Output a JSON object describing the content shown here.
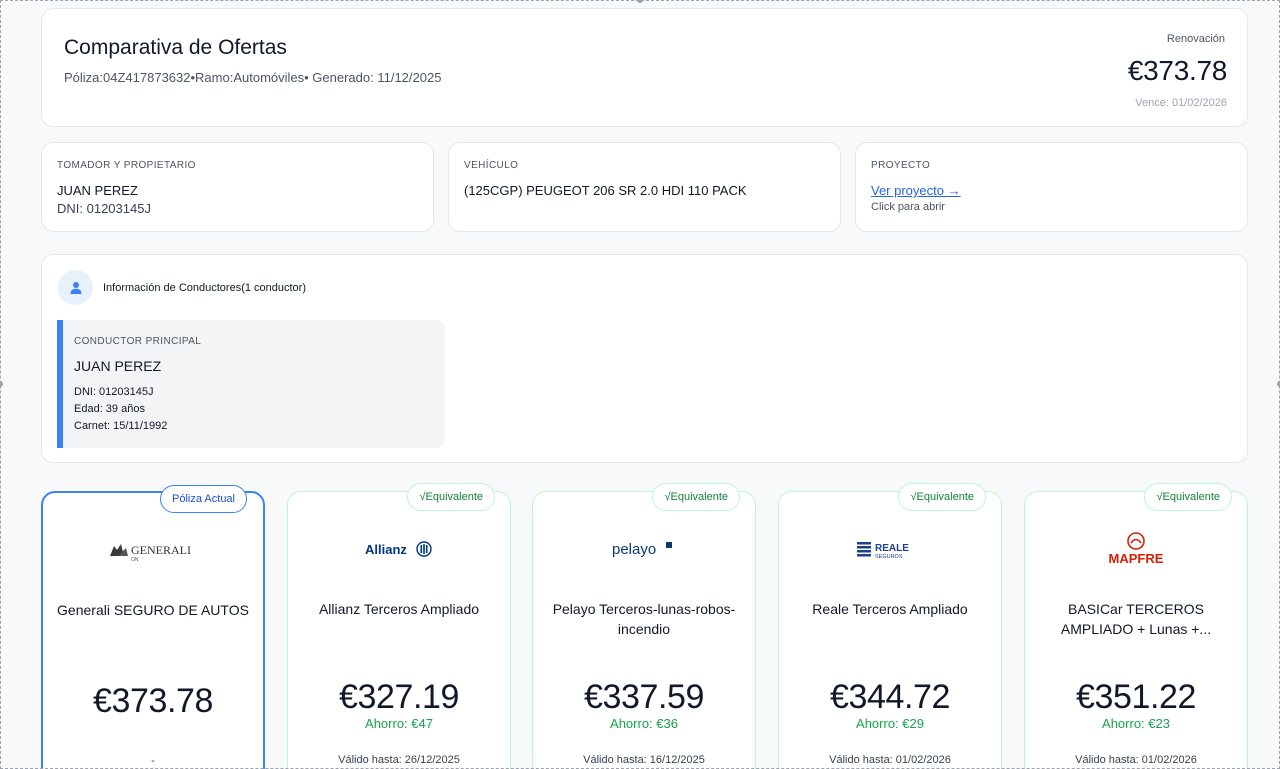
{
  "header": {
    "title": "Comparativa de Ofertas",
    "meta": "Póliza:04Z417873632•Ramo:Automóviles• Generado: 11/12/2025",
    "renewal_label": "Renovación",
    "renewal_price": "€373.78",
    "renewal_due": "Vence: 01/02/2026"
  },
  "info": {
    "holder": {
      "label": "TOMADOR Y PROPIETARIO",
      "name": "JUAN PEREZ",
      "dni": "DNI: 01203145J"
    },
    "vehicle": {
      "label": "VEHÍCULO",
      "value": "(125CGP) PEUGEOT 206 SR 2.0 HDI 110 PACK"
    },
    "project": {
      "label": "PROYECTO",
      "link": "Ver proyecto →",
      "hint": "Click para abrir"
    }
  },
  "drivers": {
    "title": "Información de Conductores(1 conductor)",
    "main": {
      "label": "CONDUCTOR PRINCIPAL",
      "name": "JUAN PEREZ",
      "dni": "DNI: 01203145J",
      "age": "Edad: 39 años",
      "license": "Carnet: 15/11/1992"
    }
  },
  "offers": [
    {
      "badge": "Póliza Actual",
      "logo": "GENERALI",
      "logo_sub": "ON",
      "name": "Generali SEGURO DE AUTOS",
      "price": "€373.78",
      "saving": "",
      "valid": "-"
    },
    {
      "badge": "√Equivalente",
      "logo": "Allianz",
      "name": "Allianz Terceros Ampliado",
      "price": "€327.19",
      "saving": "Ahorro: €47",
      "valid": "Válido hasta: 26/12/2025"
    },
    {
      "badge": "√Equivalente",
      "logo": "pelayo",
      "name": "Pelayo Terceros-lunas-robos-incendio",
      "price": "€337.59",
      "saving": "Ahorro: €36",
      "valid": "Válido hasta: 16/12/2025"
    },
    {
      "badge": "√Equivalente",
      "logo": "REALE",
      "logo_sub": "SEGUROS",
      "name": "Reale Terceros Ampliado",
      "price": "€344.72",
      "saving": "Ahorro: €29",
      "valid": "Válido hasta: 01/02/2026"
    },
    {
      "badge": "√Equivalente",
      "logo": "MAPFRE",
      "name": "BASICar TERCEROS AMPLIADO + Lunas +...",
      "price": "€351.22",
      "saving": "Ahorro: €23",
      "valid": "Válido hasta: 01/02/2026"
    }
  ],
  "colors": {
    "accent_blue": "#3b82f6",
    "equivalent_green": "#16a34a",
    "equivalent_border": "#bbf7d0",
    "mapfre_red": "#d81e05",
    "allianz_blue": "#003781"
  }
}
